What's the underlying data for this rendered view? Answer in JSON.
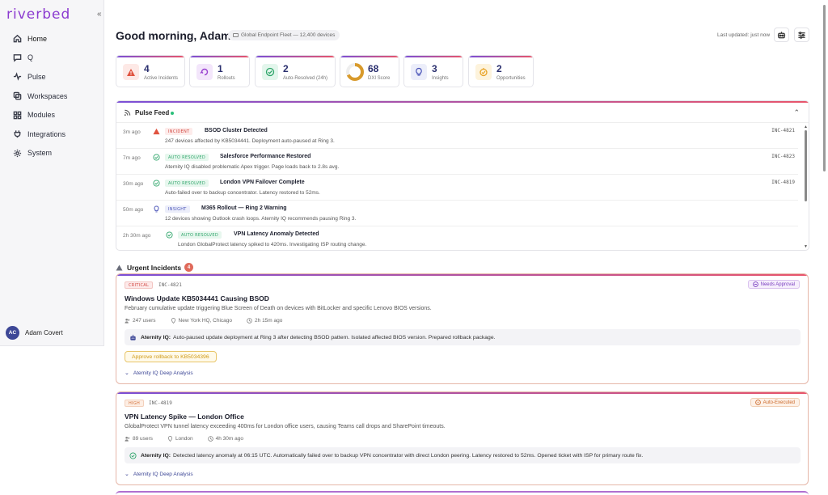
{
  "sidebar": {
    "logo": "riverbed",
    "collapse": "«",
    "items": [
      {
        "label": "Home",
        "icon": "home-icon"
      },
      {
        "label": "Q",
        "icon": "chat-icon"
      },
      {
        "label": "Pulse",
        "icon": "pulse-icon"
      },
      {
        "label": "Workspaces",
        "icon": "workspaces-icon"
      },
      {
        "label": "Modules",
        "icon": "modules-icon"
      },
      {
        "label": "Integrations",
        "icon": "plug-icon"
      },
      {
        "label": "System",
        "icon": "gear-icon"
      }
    ],
    "user": {
      "initials": "AC",
      "name": "Adam Covert"
    }
  },
  "header": {
    "greeting": "Good morning, Adam",
    "fleet": "Global Endpoint Fleet — 12,400 devices",
    "updated": "Last updated: just now"
  },
  "stats": [
    {
      "value": "4",
      "label": "Active Incidents",
      "icon": "warning-icon",
      "color": "#e0533f",
      "bg": "#fde9e6"
    },
    {
      "value": "1",
      "label": "Rollouts",
      "icon": "rollout-icon",
      "color": "#9a43d0",
      "bg": "#f3e6fb"
    },
    {
      "value": "2",
      "label": "Auto-Resolved (24h)",
      "icon": "check-circle-icon",
      "color": "#2ea56a",
      "bg": "#e3f6ec"
    },
    {
      "value": "68",
      "label": "DXI Score",
      "icon": "score-ring-icon",
      "color": "#d89a2b",
      "bg": "#ffffff"
    },
    {
      "value": "3",
      "label": "Insights",
      "icon": "lightbulb-icon",
      "color": "#4b55b8",
      "bg": "#eceefa"
    },
    {
      "value": "2",
      "label": "Opportunities",
      "icon": "opportunity-icon",
      "color": "#e8a122",
      "bg": "#fdf3dc"
    }
  ],
  "dxi_score": 0.68,
  "feed": {
    "title": "Pulse Feed",
    "items": [
      {
        "time": "3m ago",
        "tag": "INCIDENT",
        "kind": "incident",
        "title": "BSOD Cluster Detected",
        "desc": "247 devices affected by KB5034441. Deployment auto-paused at Ring 3.",
        "id": "INC-4821"
      },
      {
        "time": "7m ago",
        "tag": "AUTO RESOLVED",
        "kind": "auto",
        "title": "Salesforce Performance Restored",
        "desc": "Aternity IQ disabled problematic Apex trigger. Page loads back to 2.8s avg.",
        "id": "INC-4823"
      },
      {
        "time": "30m ago",
        "tag": "AUTO RESOLVED",
        "kind": "auto",
        "title": "London VPN Failover Complete",
        "desc": "Auto-failed over to backup concentrator. Latency restored to 52ms.",
        "id": "INC-4819"
      },
      {
        "time": "50m ago",
        "tag": "INSIGHT",
        "kind": "insight",
        "title": "M365 Rollout — Ring 2 Warning",
        "desc": "12 devices showing Outlook crash loops. Aternity IQ recommends pausing Ring 3.",
        "id": ""
      },
      {
        "time": "2h 30m ago",
        "tag": "AUTO RESOLVED",
        "kind": "auto",
        "title": "VPN Latency Anomaly Detected",
        "desc": "London GlobalProtect latency spiked to 420ms. Investigating ISP routing change.",
        "id": ""
      }
    ]
  },
  "urgent": {
    "title": "Urgent Incidents",
    "count": "4",
    "incidents": [
      {
        "severity": "CRITICAL",
        "id": "INC-4821",
        "status": "Needs Approval",
        "title": "Windows Update KB5034441 Causing BSOD",
        "desc": "February cumulative update triggering Blue Screen of Death on devices with BitLocker and specific Lenovo BIOS versions.",
        "users": "247 users",
        "location": "New York HQ, Chicago",
        "age": "2h 15m ago",
        "iq_label": "Aternity IQ:",
        "iq_text": "Auto-paused update deployment at Ring 3 after detecting BSOD pattern. Isolated affected BIOS version. Prepared rollback package.",
        "action": "Approve rollback to KB5034396",
        "deep": "Aternity IQ Deep Analysis"
      },
      {
        "severity": "HIGH",
        "id": "INC-4819",
        "status": "Auto-Executed",
        "title": "VPN Latency Spike — London Office",
        "desc": "GlobalProtect VPN tunnel latency exceeding 400ms for London office users, causing Teams call drops and SharePoint timeouts.",
        "users": "89 users",
        "location": "London",
        "age": "4h 30m ago",
        "iq_label": "Aternity IQ:",
        "iq_text": "Detected latency anomaly at 06:15 UTC. Automatically failed over to backup VPN concentrator with direct London peering. Latency restored to 52ms. Opened ticket with ISP for primary route fix.",
        "deep": "Aternity IQ Deep Analysis"
      }
    ]
  }
}
